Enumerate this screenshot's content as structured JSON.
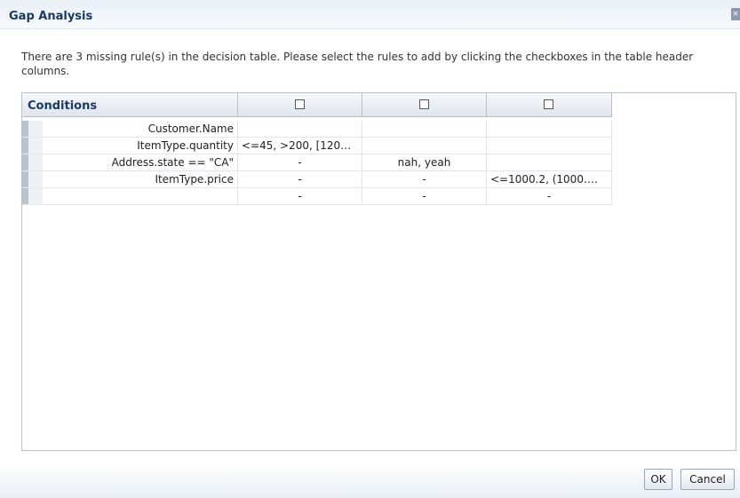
{
  "dialog": {
    "title": "Gap Analysis",
    "close_icon": "close-icon"
  },
  "message": "There are 3 missing rule(s) in the decision table. Please select the rules to add by clicking the checkboxes in the table header columns.",
  "table": {
    "header": {
      "conditions_label": "Conditions",
      "rule_checkboxes": [
        {
          "checked": false
        },
        {
          "checked": false
        },
        {
          "checked": false
        }
      ]
    },
    "rows": [
      {
        "label": "Customer.Name",
        "cells": [
          "",
          "",
          ""
        ]
      },
      {
        "label": "ItemType.quantity",
        "cells": [
          "<=45, >200, [120…",
          "",
          ""
        ]
      },
      {
        "label": "Address.state == \"CA\"",
        "cells": [
          "-",
          "nah, yeah",
          ""
        ]
      },
      {
        "label": "ItemType.price",
        "cells": [
          "-",
          "-",
          "<=1000.2, (1000…."
        ]
      },
      {
        "label": "",
        "cells": [
          "-",
          "-",
          "-"
        ]
      }
    ]
  },
  "buttons": {
    "ok": "OK",
    "cancel": "Cancel"
  }
}
